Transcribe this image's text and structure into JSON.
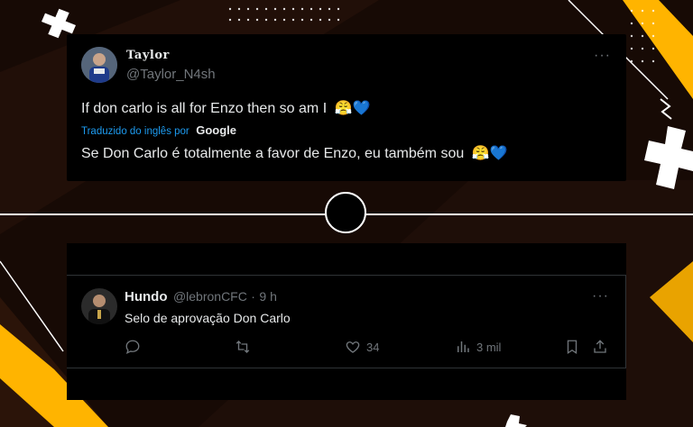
{
  "tweet1": {
    "display_name": "Taylor",
    "handle": "@Taylor_N4sh",
    "text": "If don carlo is all for Enzo then so am I",
    "emojis": "😤💙",
    "translated_label": "Traduzido do inglês por",
    "translator": "Google",
    "translation": "Se Don Carlo é totalmente a favor de Enzo, eu também sou",
    "translation_emojis": "😤💙",
    "more": "···"
  },
  "tweet2": {
    "display_name": "Hundo",
    "handle": "@lebronCFC",
    "separator": "·",
    "time": "9 h",
    "text": "Selo de aprovação Don Carlo",
    "more": "···",
    "actions": {
      "reply_count": "",
      "retweet_count": "",
      "like_count": "34",
      "views_count": "3 mil"
    }
  },
  "colors": {
    "accent_yellow": "#ffb400",
    "link_blue": "#1d9bf0",
    "background": "#1a0c07"
  }
}
